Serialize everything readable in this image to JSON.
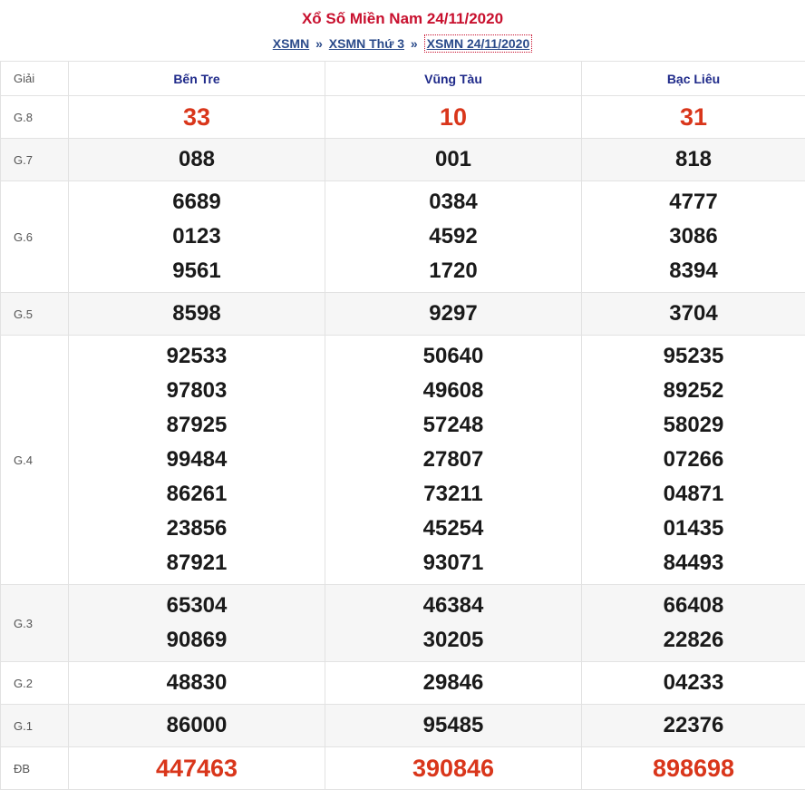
{
  "header": {
    "title": "Xổ Số Miền Nam 24/11/2020",
    "breadcrumb": [
      "XSMN",
      "XSMN Thứ 3",
      "XSMN 24/11/2020"
    ],
    "separator": "»"
  },
  "table": {
    "prize_header": "Giải",
    "provinces": [
      "Bến Tre",
      "Vũng Tàu",
      "Bạc Liêu"
    ],
    "rows": [
      {
        "prize": "G.8",
        "results": [
          [
            "33"
          ],
          [
            "10"
          ],
          [
            "31"
          ]
        ]
      },
      {
        "prize": "G.7",
        "results": [
          [
            "088"
          ],
          [
            "001"
          ],
          [
            "818"
          ]
        ]
      },
      {
        "prize": "G.6",
        "results": [
          [
            "6689",
            "0123",
            "9561"
          ],
          [
            "0384",
            "4592",
            "1720"
          ],
          [
            "4777",
            "3086",
            "8394"
          ]
        ]
      },
      {
        "prize": "G.5",
        "results": [
          [
            "8598"
          ],
          [
            "9297"
          ],
          [
            "3704"
          ]
        ]
      },
      {
        "prize": "G.4",
        "results": [
          [
            "92533",
            "97803",
            "87925",
            "99484",
            "86261",
            "23856",
            "87921"
          ],
          [
            "50640",
            "49608",
            "57248",
            "27807",
            "73211",
            "45254",
            "93071"
          ],
          [
            "95235",
            "89252",
            "58029",
            "07266",
            "04871",
            "01435",
            "84493"
          ]
        ]
      },
      {
        "prize": "G.3",
        "results": [
          [
            "65304",
            "90869"
          ],
          [
            "46384",
            "30205"
          ],
          [
            "66408",
            "22826"
          ]
        ]
      },
      {
        "prize": "G.2",
        "results": [
          [
            "48830"
          ],
          [
            "29846"
          ],
          [
            "04233"
          ]
        ]
      },
      {
        "prize": "G.1",
        "results": [
          [
            "86000"
          ],
          [
            "95485"
          ],
          [
            "22376"
          ]
        ]
      },
      {
        "prize": "ĐB",
        "results": [
          [
            "447463"
          ],
          [
            "390846"
          ],
          [
            "898698"
          ]
        ]
      }
    ]
  },
  "colors": {
    "title": "#c8102e",
    "link": "#2a4a8a",
    "province": "#1f2a8a",
    "highlight": "#d9361b"
  }
}
